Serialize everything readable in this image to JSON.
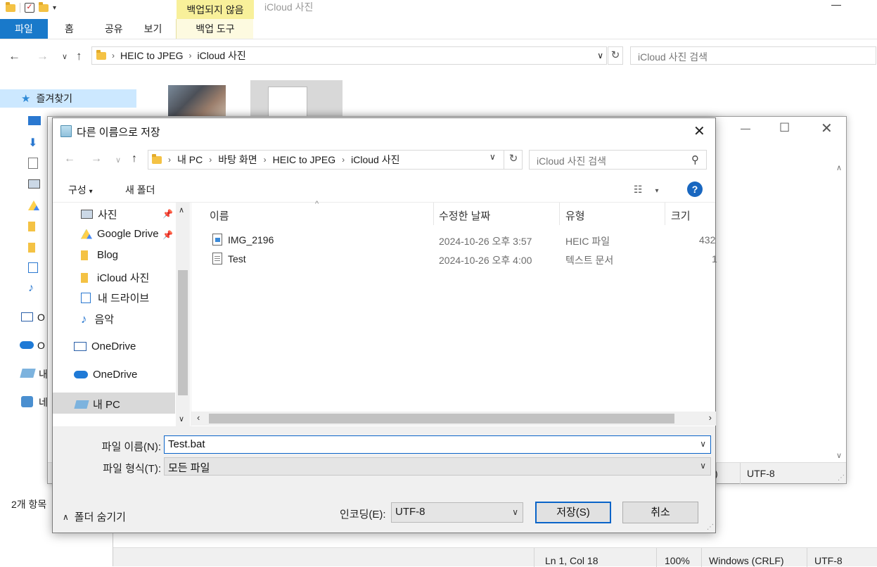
{
  "explorer": {
    "ribbon_context_label": "백업되지 않음",
    "window_title": "iCloud 사진",
    "tabs": [
      "파일",
      "홈",
      "공유",
      "보기"
    ],
    "context_tab": "백업 도구",
    "breadcrumb": [
      "HEIC to JPEG",
      "iCloud 사진"
    ],
    "search_placeholder": "iCloud 사진 검색",
    "favorites": "즐겨찾기",
    "sidebar_clipped": [
      "O",
      "O",
      "내",
      "네"
    ],
    "status_items": "2개 항목"
  },
  "notepad": {
    "status_encoding": "UTF-8",
    "status_clip": ")",
    "bottom_status": {
      "position": "Ln 1, Col 18",
      "zoom": "100%",
      "line_ending": "Windows (CRLF)",
      "encoding": "UTF-8"
    }
  },
  "dialog": {
    "title": "다른 이름으로 저장",
    "breadcrumb": [
      "내 PC",
      "바탕 화면",
      "HEIC to JPEG",
      "iCloud 사진"
    ],
    "search_placeholder": "iCloud 사진 검색",
    "toolbar": {
      "organize": "구성",
      "new_folder": "새 폴더"
    },
    "nav_items": [
      {
        "label": "사진",
        "pinned": true
      },
      {
        "label": "Google Drive",
        "pinned": true
      },
      {
        "label": "Blog"
      },
      {
        "label": "iCloud 사진"
      },
      {
        "label": "내 드라이브"
      },
      {
        "label": "음악"
      },
      {
        "label": "OneDrive"
      },
      {
        "label": "OneDrive"
      },
      {
        "label": "내 PC"
      }
    ],
    "columns": [
      "이름",
      "수정한 날짜",
      "유형",
      "크기"
    ],
    "files": [
      {
        "name": "IMG_2196",
        "modified": "2024-10-26 오후 3:57",
        "type": "HEIC 파일",
        "size": "432"
      },
      {
        "name": "Test",
        "modified": "2024-10-26 오후 4:00",
        "type": "텍스트 문서",
        "size": "1"
      }
    ],
    "filename_label": "파일 이름(N):",
    "filename_value": "Test.bat",
    "filetype_label": "파일 형식(T):",
    "filetype_value": "모든 파일",
    "hide_folders": "폴더 숨기기",
    "encoding_label": "인코딩(E):",
    "encoding_value": "UTF-8",
    "save_button": "저장(S)",
    "cancel_button": "취소"
  }
}
